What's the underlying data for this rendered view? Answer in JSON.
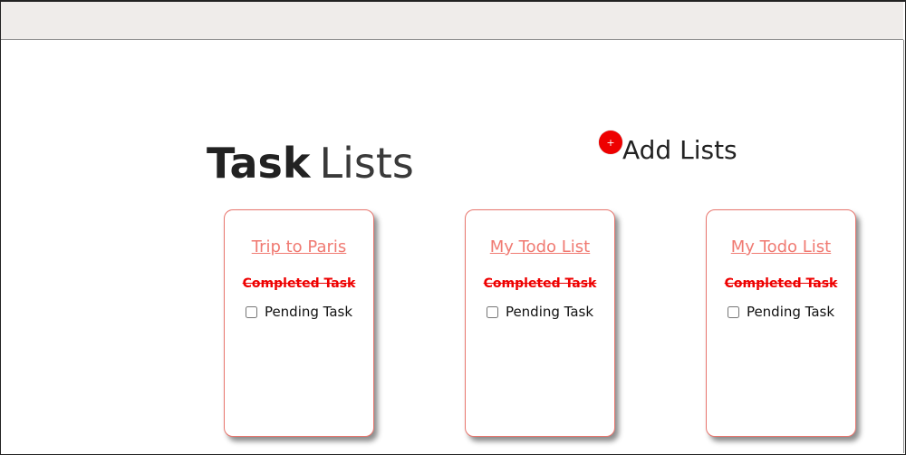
{
  "heading": {
    "bold": "Task",
    "light": "Lists"
  },
  "add_lists": {
    "icon": "+",
    "label": "Add Lists"
  },
  "lists": [
    {
      "title": "Trip to Paris",
      "completed_task": "Completed Task",
      "pending_task": "Pending Task",
      "pending_checked": false
    },
    {
      "title": "My Todo List",
      "completed_task": "Completed Task",
      "pending_task": "Pending Task",
      "pending_checked": false
    },
    {
      "title": "My Todo List",
      "completed_task": "Completed Task",
      "pending_task": "Pending Task",
      "pending_checked": false
    }
  ],
  "colors": {
    "accent_red": "#ee0000",
    "card_border": "#e8766e",
    "title_link": "#f07a72",
    "topbar": "#efecea"
  }
}
